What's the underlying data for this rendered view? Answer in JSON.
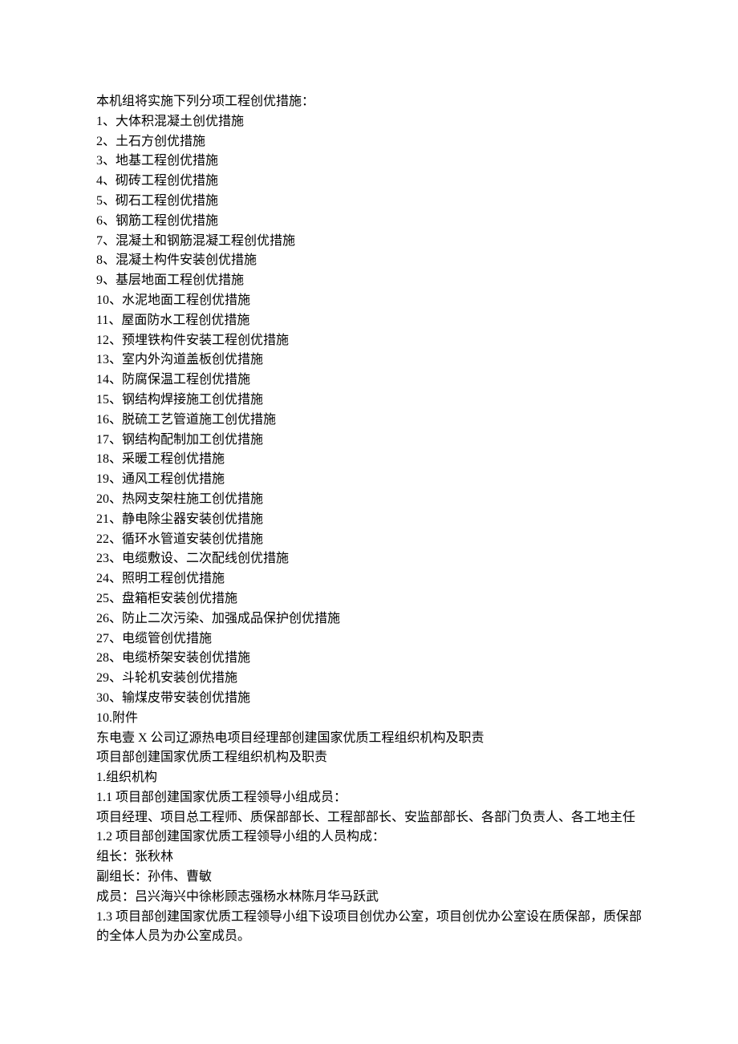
{
  "intro": "本机组将实施下列分项工程创优措施：",
  "items": [
    "1、大体积混凝土创优措施",
    "2、土石方创优措施",
    "3、地基工程创优措施",
    "4、砌砖工程创优措施",
    "5、砌石工程创优措施",
    "6、钢筋工程创优措施",
    "7、混凝土和钢筋混凝工程创优措施",
    "8、混凝土构件安装创优措施",
    "9、基层地面工程创优措施",
    "10、水泥地面工程创优措施",
    "11、屋面防水工程创优措施",
    "12、预埋铁构件安装工程创优措施",
    "13、室内外沟道盖板创优措施",
    "14、防腐保温工程创优措施",
    "15、钢结构焊接施工创优措施",
    "16、脱硫工艺管道施工创优措施",
    "17、钢结构配制加工创优措施",
    "18、采暖工程创优措施",
    "19、通风工程创优措施",
    "20、热网支架柱施工创优措施",
    "21、静电除尘器安装创优措施",
    "22、循环水管道安装创优措施",
    "23、电缆敷设、二次配线创优措施",
    "24、照明工程创优措施",
    "25、盘箱柜安装创优措施",
    "26、防止二次污染、加强成品保护创优措施",
    "27、电缆管创优措施",
    "28、电缆桥架安装创优措施",
    "29、斗轮机安装创优措施",
    "30、输煤皮带安装创优措施"
  ],
  "appendix_header": "10.附件",
  "appendix_title": "东电壹 X 公司辽源热电项目经理部创建国家优质工程组织机构及职责",
  "section_title": "项目部创建国家优质工程组织机构及职责",
  "org_heading": "1.组织机构",
  "org_1_1": "1.1 项目部创建国家优质工程领导小组成员：",
  "org_1_1_detail": "项目经理、项目总工程师、质保部部长、工程部部长、安监部部长、各部门负责人、各工地主任",
  "org_1_2": "1.2 项目部创建国家优质工程领导小组的人员构成：",
  "leader": "组长：张秋林",
  "vice_leader": "副组长：孙伟、曹敏",
  "members": "成员：吕兴海兴中徐彬顾志强杨水林陈月华马跃武",
  "org_1_3": "1.3 项目部创建国家优质工程领导小组下设项目创优办公室，项目创优办公室设在质保部，质保部的全体人员为办公室成员。"
}
